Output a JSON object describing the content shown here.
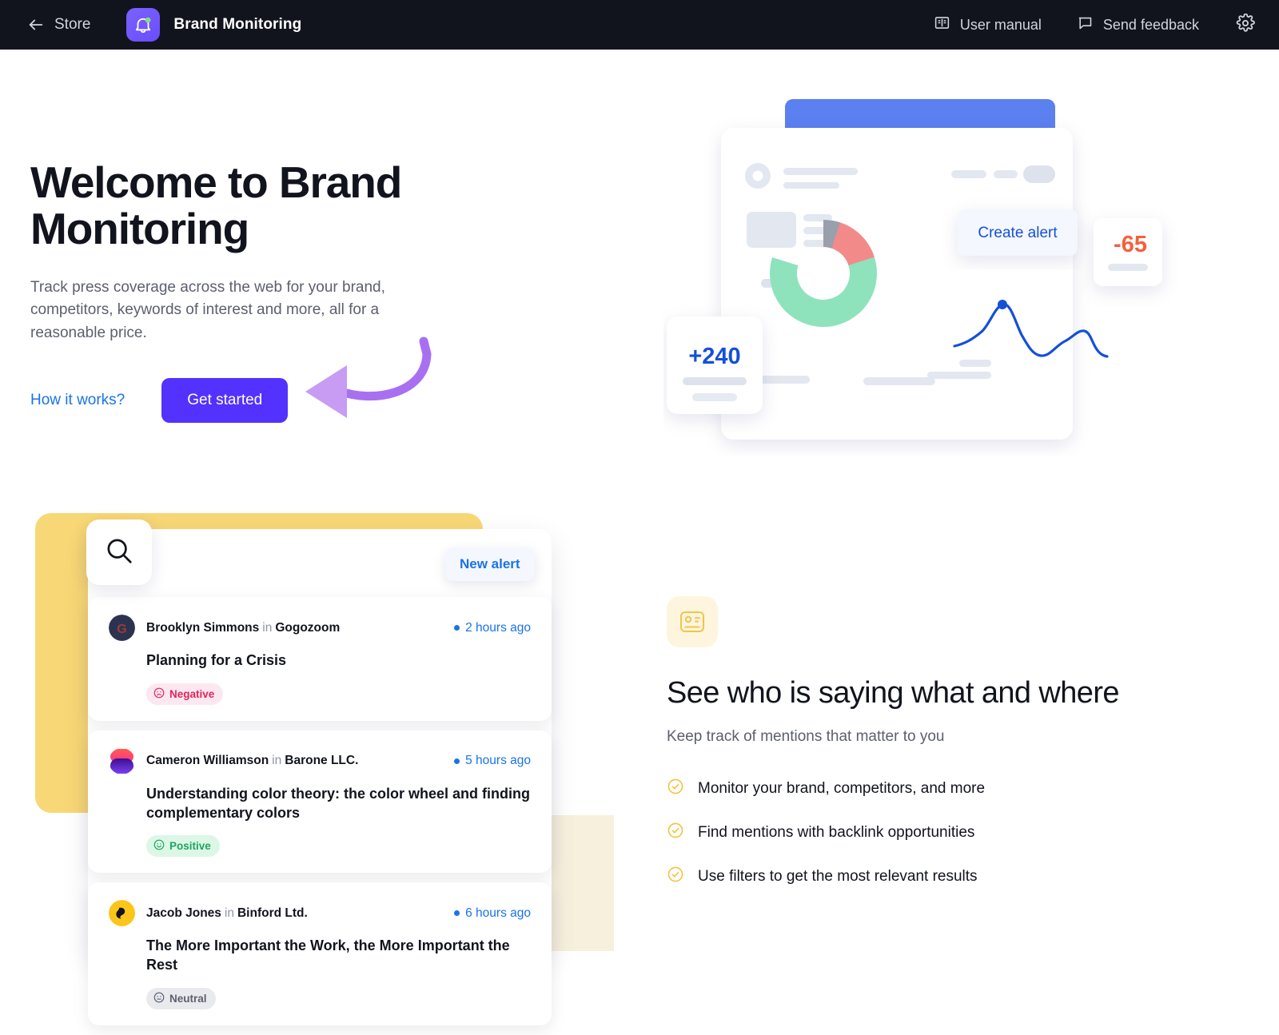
{
  "topbar": {
    "back_label": "Store",
    "back_icon": "arrow-left-icon",
    "app_icon": "bell-alert-icon",
    "app_title": "Brand Monitoring",
    "user_manual_label": "User manual",
    "user_manual_icon": "book-icon",
    "send_feedback_label": "Send feedback",
    "send_feedback_icon": "speech-bubble-icon",
    "settings_icon": "gear-icon",
    "bg_color": "#12141d"
  },
  "hero": {
    "title": "Welcome to Brand Monitoring",
    "subtitle": "Track press coverage across the web for your brand, competitors, keywords of interest and more, all for a reasonable price.",
    "how_it_works_label": "How it works?",
    "get_started_label": "Get started",
    "primary_color": "#5331ff",
    "link_color": "#1a73e8",
    "annotation_arrow_color": "#a870f0"
  },
  "illustration": {
    "create_alert_label": "Create alert",
    "metric_positive": "+240",
    "metric_negative": "-65",
    "back_panel_color": "#5b80f0",
    "donut": {
      "segments": [
        {
          "name": "positive",
          "value": 72,
          "color": "#8ee3bd"
        },
        {
          "name": "negative",
          "value": 18,
          "color": "#f38a8a"
        },
        {
          "name": "neutral",
          "value": 10,
          "color": "#9aa0ab"
        }
      ]
    },
    "line_color": "#1450d8"
  },
  "mentions": {
    "search_icon": "search-icon",
    "new_alert_label": "New alert",
    "in_word": "in",
    "items": [
      {
        "author": "Brooklyn Simmons",
        "source": "Gogozoom",
        "time": "2 hours ago",
        "title": "Planning for a Crisis",
        "sentiment": "Negative",
        "sentiment_key": "negative",
        "avatar_kind": "letter-g-dark"
      },
      {
        "author": "Cameron Williamson",
        "source": "Barone LLC.",
        "time": "5 hours ago",
        "title": "Understanding color theory: the color wheel and finding complementary colors",
        "sentiment": "Positive",
        "sentiment_key": "positive",
        "avatar_kind": "gradient-stack"
      },
      {
        "author": "Jacob Jones",
        "source": "Binford Ltd.",
        "time": "6 hours ago",
        "title": "The More Important the Work, the More Important the Rest",
        "sentiment": "Neutral",
        "sentiment_key": "neutral",
        "avatar_kind": "yellow-glyph"
      }
    ]
  },
  "feature": {
    "icon": "contact-card-icon",
    "title": "See who is saying what and where",
    "subtitle": "Keep track of mentions that matter to you",
    "bullets": [
      "Monitor your brand, competitors, and more",
      "Find mentions with backlink opportunities",
      "Use filters to get the most relevant results"
    ],
    "accent_color": "#f5c344"
  }
}
